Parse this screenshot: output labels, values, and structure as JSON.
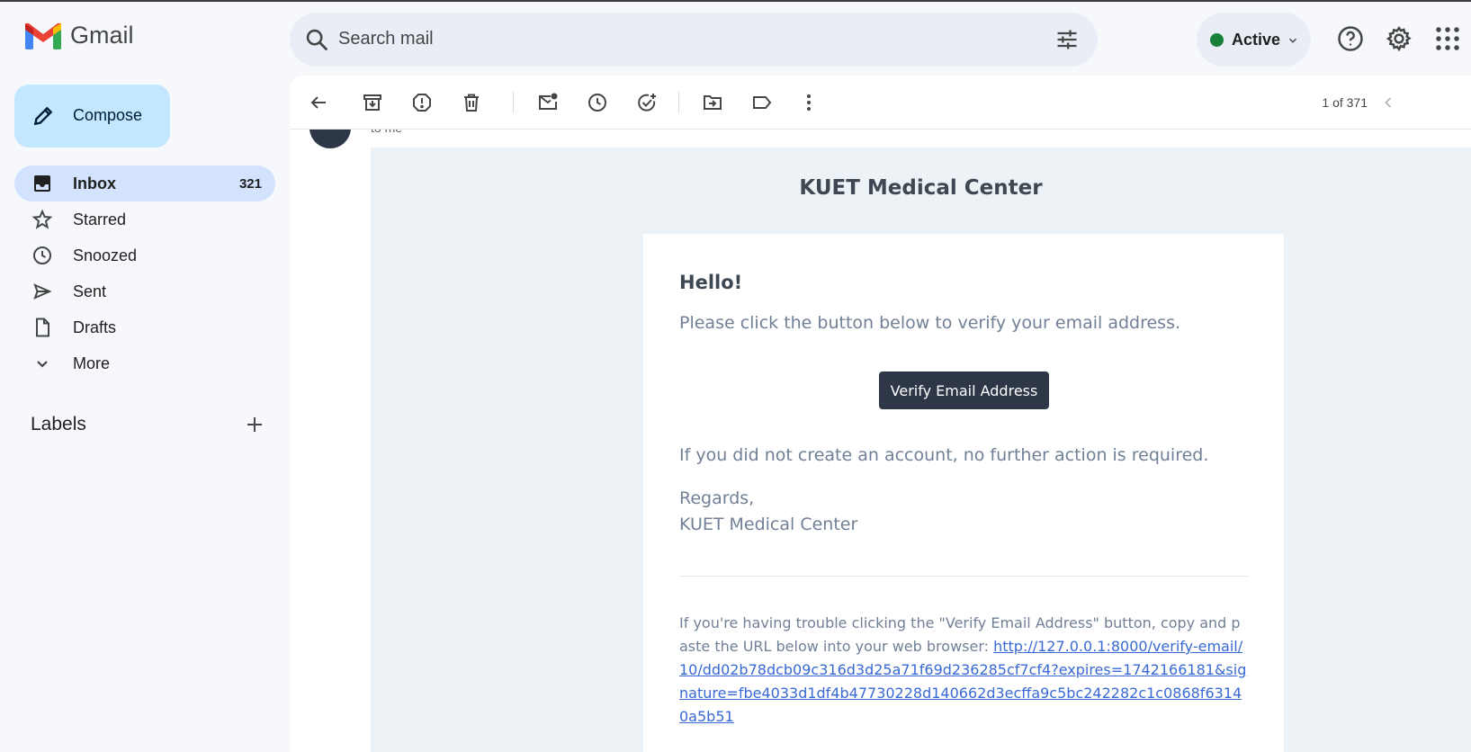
{
  "app": {
    "name": "Gmail"
  },
  "search": {
    "placeholder": "Search mail"
  },
  "status": {
    "label": "Active",
    "color": "#188038"
  },
  "sidebar": {
    "compose_label": "Compose",
    "items": [
      {
        "label": "Inbox",
        "count": "321",
        "icon": "inbox-icon",
        "active": true
      },
      {
        "label": "Starred",
        "icon": "star-icon"
      },
      {
        "label": "Snoozed",
        "icon": "clock-icon"
      },
      {
        "label": "Sent",
        "icon": "send-icon"
      },
      {
        "label": "Drafts",
        "icon": "draft-icon"
      },
      {
        "label": "More",
        "icon": "chevron-down-icon"
      }
    ],
    "labels_heading": "Labels"
  },
  "toolbar": {
    "pager": "1 of 371"
  },
  "email": {
    "recipient": "to me",
    "brand": "KUET Medical Center",
    "greeting": "Hello!",
    "intro": "Please click the button below to verify your email address.",
    "button_label": "Verify Email Address",
    "outro": "If you did not create an account, no further action is required.",
    "regards": "Regards,",
    "signature": "KUET Medical Center",
    "subcopy_text": "If you're having trouble clicking the \"Verify Email Address\" button, copy and paste the URL below into your web browser: ",
    "verify_url": "http://127.0.0.1:8000/verify-email/10/dd02b78dcb09c316d3d25a71f69d236285cf7cf4?expires=1742166181&signature=fbe4033d1df4b47730228d140662d3ecffa9c5bc242282c1c0868f63140a5b51"
  },
  "colors": {
    "accent": "#c2e7ff",
    "active_nav": "#d3e3fd",
    "button": "#2d3748",
    "link": "#3869d4"
  }
}
